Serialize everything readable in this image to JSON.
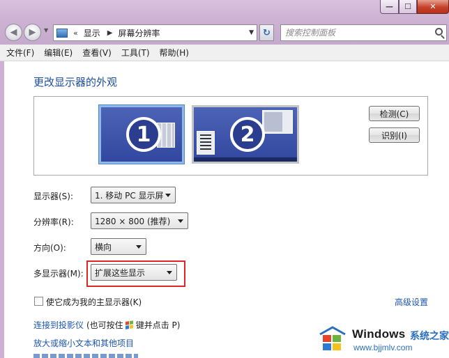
{
  "window": {
    "min_glyph": "—",
    "max_glyph": "☐",
    "close_glyph": "✕"
  },
  "nav": {
    "breadcrumb_chevron": "«",
    "breadcrumb": [
      "显示",
      "屏幕分辨率"
    ],
    "search_placeholder": "搜索控制面板"
  },
  "menubar": {
    "items": [
      "文件(F)",
      "编辑(E)",
      "查看(V)",
      "工具(T)",
      "帮助(H)"
    ]
  },
  "main": {
    "title": "更改显示器的外观",
    "monitors": [
      "1",
      "2"
    ],
    "detect_button": "检测(C)",
    "identify_button": "识别(I)",
    "fields": {
      "display_label": "显示器(S):",
      "display_value": "1. 移动 PC 显示屏",
      "resolution_label": "分辨率(R):",
      "resolution_value": "1280 × 800 (推荐)",
      "orientation_label": "方向(O):",
      "orientation_value": "横向",
      "multi_display_label": "多显示器(M):",
      "multi_display_value": "扩展这些显示"
    },
    "primary_checkbox_label": "使它成为我的主显示器(K)",
    "advanced_link": "高级设置",
    "projector_link": "连接到投影仪",
    "projector_hint_pre": "(也可按住",
    "projector_hint_post": "键并点击 P)",
    "text_size_link": "放大或缩小文本和其他项目"
  },
  "watermark": {
    "brand": "Windows",
    "brand_cn": "系统之家",
    "url": "www.bjjmlv.com"
  },
  "colors": {
    "accent_link": "#1c56b0",
    "title_blue": "#1d4fa0",
    "highlight_red": "#e02525",
    "chrome_purple": "#cdb2d4"
  }
}
